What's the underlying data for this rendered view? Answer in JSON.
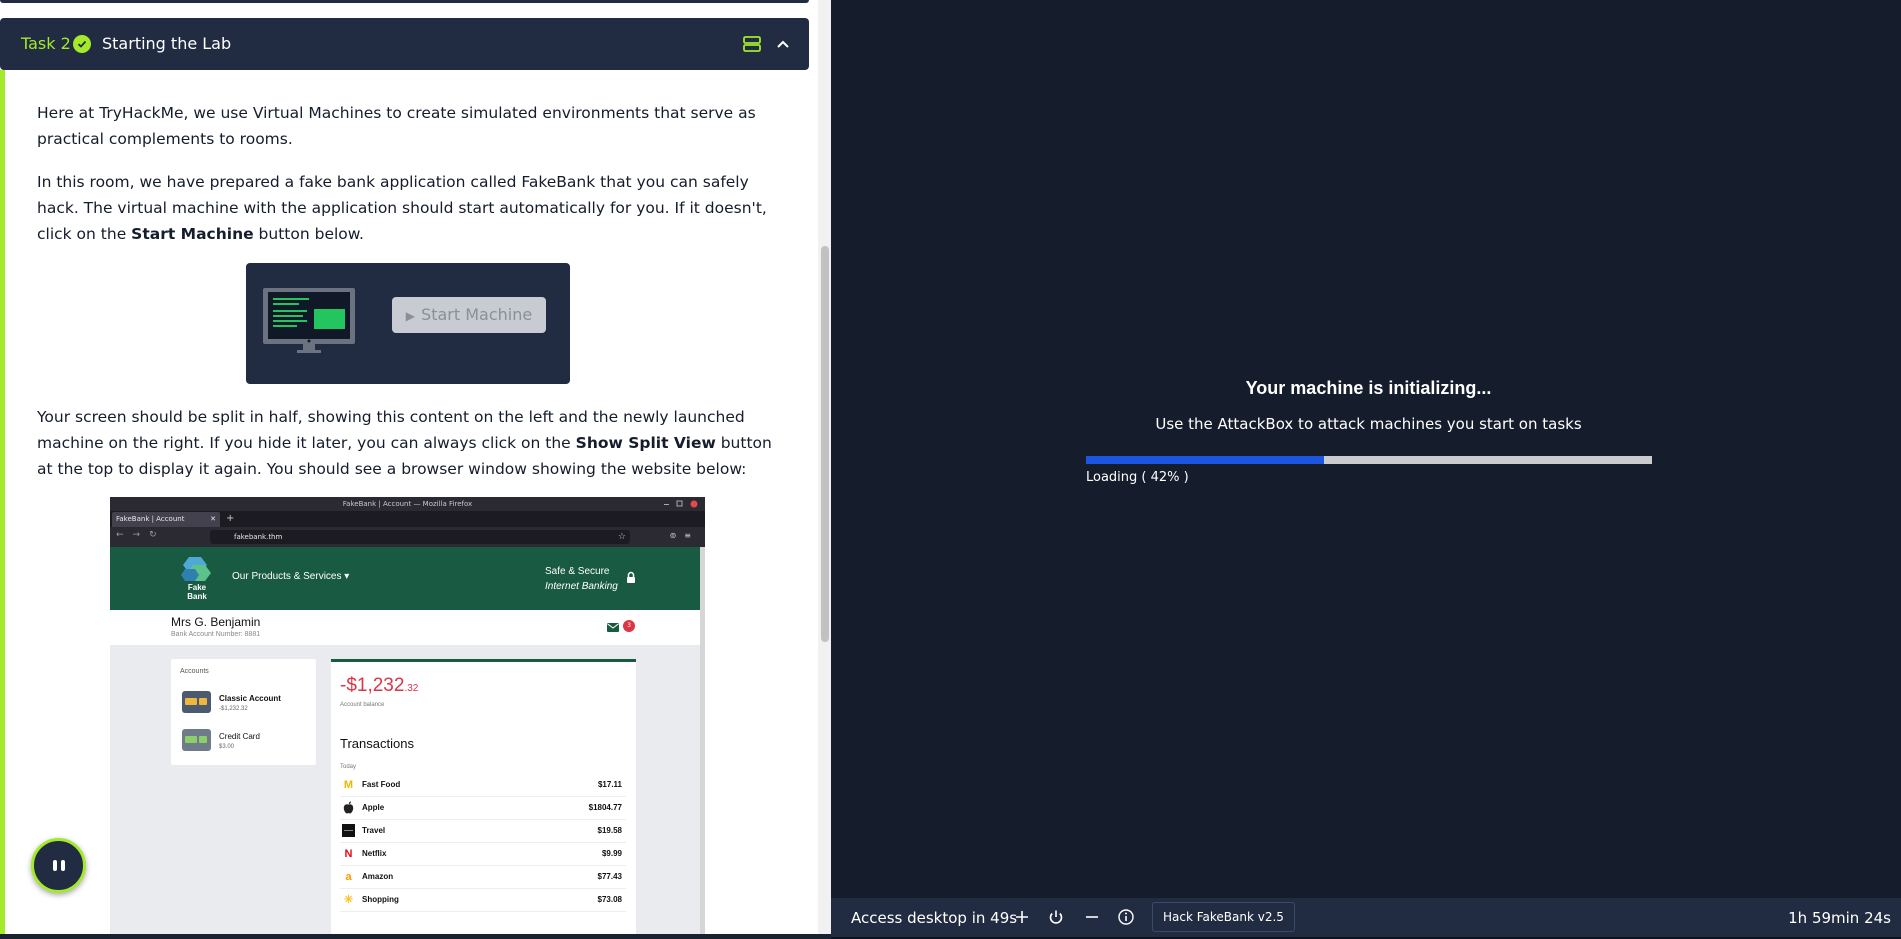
{
  "task": {
    "label": "Task 2",
    "title": "Starting the Lab"
  },
  "content": {
    "p1": "Here at TryHackMe, we use Virtual Machines to create simulated environments that serve as practical complements to rooms.",
    "p2_pre": "In this room, we have prepared a fake bank application called FakeBank that you can safely hack. The virtual machine with the application should start automatically for you. If it doesn't, click on the ",
    "p2_bold": "Start Machine",
    "p2_post": " button below.",
    "start_button": "Start Machine",
    "p3_pre": "Your screen should be split in half, showing this content on the left and the newly launched machine on the right. If you hide it later, you can always click on the ",
    "p3_bold": "Show Split View",
    "p3_post": " button at the top to display it again. You should see a browser window showing the website below:"
  },
  "fakebank_screenshot": {
    "window_title": "FakeBank | Account — Mozilla Firefox",
    "tab_title": "FakeBank | Account",
    "url": "fakebank.thm",
    "logo_text": "Fake Bank",
    "products_menu": "Our Products & Services ▾",
    "safe_line1": "Safe & Secure",
    "safe_line2": "Internet Banking",
    "user_name": "Mrs G. Benjamin",
    "account_number": "Bank Account Number: 8881",
    "mail_badge": "3",
    "accounts_title": "Accounts",
    "accounts": [
      {
        "name": "Classic Account",
        "amount": "-$1,232.32"
      },
      {
        "name": "Credit Card",
        "amount": "$3.00"
      }
    ],
    "balance_main": "-$1,232",
    "balance_cents": ".32",
    "balance_label": "Account balance",
    "transactions_title": "Transactions",
    "transactions_day": "Today",
    "transactions": [
      {
        "icon": "M",
        "color": "#f5b400",
        "name": "Fast Food",
        "amount": "$17.11"
      },
      {
        "icon": "",
        "color": "#222222",
        "name": "Apple",
        "amount": "$1804.77"
      },
      {
        "icon": "■",
        "color": "#111111",
        "name": "Travel",
        "amount": "$19.58"
      },
      {
        "icon": "N",
        "color": "#e50914",
        "name": "Netflix",
        "amount": "$9.99"
      },
      {
        "icon": "a",
        "color": "#ff9900",
        "name": "Amazon",
        "amount": "$77.43"
      },
      {
        "icon": "✳",
        "color": "#ffc220",
        "name": "Shopping",
        "amount": "$73.08"
      }
    ]
  },
  "machine": {
    "title": "Your machine is initializing...",
    "subtitle": "Use the AttackBox to attack machines you start on tasks",
    "progress_fraction": 0.42,
    "progress_label": "Loading ( 42% )"
  },
  "statusbar": {
    "access_text": "Access desktop in 49s",
    "machine_chip": "Hack FakeBank v2.5",
    "timer": "1h 59min 24s"
  },
  "colors": {
    "navy": "#212c42",
    "accent_green": "#a3ea2a",
    "dark_bg": "#151c2b",
    "progress_blue": "#1b55e0",
    "fakebank_green": "#195a42"
  }
}
